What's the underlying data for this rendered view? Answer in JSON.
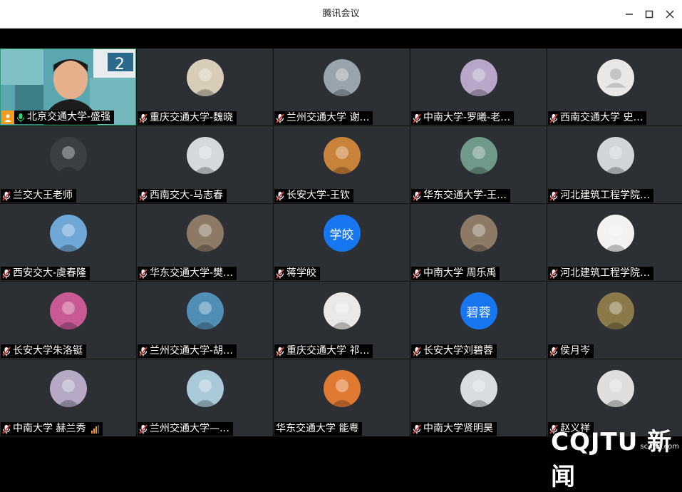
{
  "window": {
    "title": "腾讯会议"
  },
  "participants": [
    {
      "name": "北京交通大学-盛强",
      "avatar": "video",
      "self": true
    },
    {
      "name": "重庆交通大学-魏晓",
      "avatar": "drawing-icon"
    },
    {
      "name": "兰州交通大学  谢…",
      "avatar": "person-photo-icon"
    },
    {
      "name": "中南大学-罗曦-老…",
      "avatar": "map-icon"
    },
    {
      "name": "西南交通大学  史…",
      "avatar": "default-user-icon"
    },
    {
      "name": "兰交大王老师",
      "avatar": "room-photo-icon"
    },
    {
      "name": "西南交大-马志春",
      "avatar": "building-icon"
    },
    {
      "name": "长安大学-王钦",
      "avatar": "cartoon-icon"
    },
    {
      "name": "华东交通大学-王…",
      "avatar": "landscape-icon"
    },
    {
      "name": "河北建筑工程学院…",
      "avatar": "anime-icon"
    },
    {
      "name": "西安交大-虞春隆",
      "avatar": "sea-icon"
    },
    {
      "name": "华东交通大学-樊…",
      "avatar": "portrait-icon"
    },
    {
      "name": "蒋学皎",
      "avatar": "text",
      "avatar_text": "学皎"
    },
    {
      "name": "中南大学 周乐禹",
      "avatar": "portrait-icon"
    },
    {
      "name": "河北建筑工程学院…",
      "avatar": "penguin-icon"
    },
    {
      "name": "长安大学朱洛铤",
      "avatar": "anime-girl-icon"
    },
    {
      "name": "兰州交通大学-胡…",
      "avatar": "illustration-icon"
    },
    {
      "name": "重庆交通大学  祁…",
      "avatar": "sketch-icon"
    },
    {
      "name": "长安大学刘碧蓉",
      "avatar": "text",
      "avatar_text": "碧蓉"
    },
    {
      "name": "侯月岑",
      "avatar": "bird-icon"
    },
    {
      "name": "中南大学  赫兰秀",
      "avatar": "girl-photo-icon",
      "signal": true
    },
    {
      "name": "兰州交通大学—…",
      "avatar": "swim-icon"
    },
    {
      "name": "华东交通大学  能粤",
      "avatar": "cat-icon",
      "no_mic": true
    },
    {
      "name": "中南大学贤明昊",
      "avatar": "cartoon-boy-icon"
    },
    {
      "name": "赵义祥",
      "avatar": "boy-photo-icon"
    }
  ],
  "watermark": {
    "brand": "CQJTU 新闻",
    "site": "sc-rac.com"
  },
  "colors": {
    "tile_bg": "#2c2f33",
    "text_avatar_bg": "#1677f0",
    "mic_muted": "#e0403a",
    "self_badge": "#f29c1f"
  }
}
